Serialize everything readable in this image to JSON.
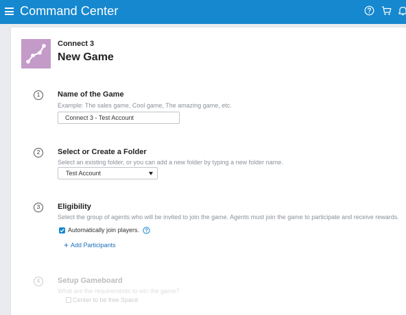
{
  "header": {
    "title": "Command Center",
    "icons": [
      "menu-icon",
      "help-icon",
      "cart-icon",
      "bell-icon"
    ],
    "color": "#1688cf"
  },
  "game": {
    "parent": "Connect 3",
    "title": "New Game",
    "thumbnail_color": "#c49ac9"
  },
  "steps": [
    {
      "number": "1",
      "title": "Name of the Game",
      "help": "Example: The sales game, Cool game, The amazing game, etc.",
      "input_value": "Connect 3 - Test Account"
    },
    {
      "number": "2",
      "title": "Select or Create a Folder",
      "help": "Select an existing folder, or you can add a new folder by typing a new folder name.",
      "select_value": "Test Account"
    },
    {
      "number": "3",
      "title": "Eligibility",
      "help": "Select the group of agents who will be invited to join the game. Agents must join the game to participate and receive rewards.",
      "checkbox_label": "Automatically join players.",
      "checkbox_checked": true,
      "add_link": "Add Participants"
    },
    {
      "number": "4",
      "title": "Setup Gameboard",
      "help": "What are the requirements to win the game?",
      "checkbox_label": "Center to be free Space"
    }
  ]
}
